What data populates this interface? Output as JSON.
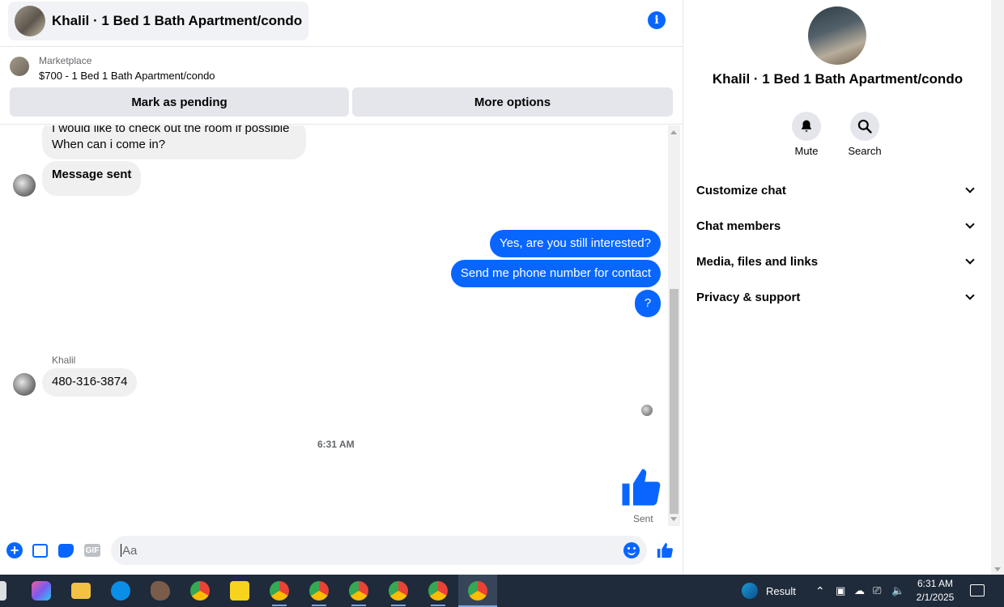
{
  "header": {
    "title": "Khalil · 1 Bed 1 Bath Apartment/condo",
    "info_icon": "i"
  },
  "marketplace": {
    "label": "Marketplace",
    "item": "$700 - 1 Bed 1 Bath Apartment/condo",
    "mark_pending": "Mark as pending",
    "more_options": "More options"
  },
  "messages": {
    "incoming_1_line1": "I would like to check out the room if possible",
    "incoming_1_line2": "When can i come in?",
    "incoming_2": "Message sent",
    "outgoing_1": "Yes, are you still interested?",
    "outgoing_2": "Send me phone number for contact",
    "outgoing_3": "?",
    "sender_name": "Khalil",
    "incoming_3": "480-316-3874",
    "timestamp": "6:31 AM",
    "sent_status": "Sent"
  },
  "composer": {
    "placeholder": "Aa",
    "gif_label": "GIF"
  },
  "panel": {
    "name": "Khalil · 1 Bed 1 Bath Apartment/condo",
    "mute_label": "Mute",
    "search_label": "Search",
    "rows": [
      {
        "label": "Customize chat"
      },
      {
        "label": "Chat members"
      },
      {
        "label": "Media, files and links"
      },
      {
        "label": "Privacy & support"
      }
    ]
  },
  "taskbar": {
    "result_label": "Result",
    "time": "6:31 AM",
    "date": "2/1/2025"
  },
  "colors": {
    "accent": "#0866ff",
    "bubble_in": "#f0f0f0",
    "taskbar": "#1f2a3a"
  }
}
